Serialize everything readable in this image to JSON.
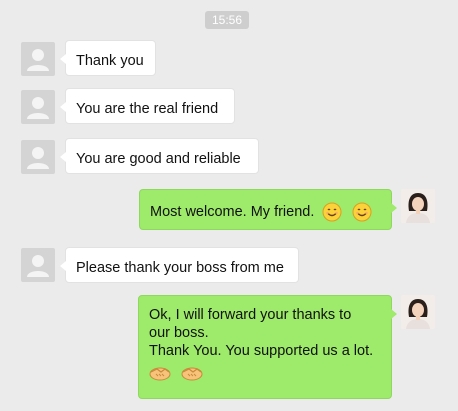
{
  "chat": {
    "timestamp": "15:56",
    "messages": [
      {
        "direction": "incoming",
        "text": "Thank you"
      },
      {
        "direction": "incoming",
        "text": "You are the real friend"
      },
      {
        "direction": "incoming",
        "text": "You are good and reliable"
      },
      {
        "direction": "outgoing",
        "text": "Most welcome. My friend.",
        "emojis": [
          "smile-emoji",
          "smile-emoji"
        ]
      },
      {
        "direction": "incoming",
        "text": "Please thank your boss from me"
      },
      {
        "direction": "outgoing",
        "lines": [
          "Ok, I will forward your thanks to",
          "our boss.",
          "Thank You. You supported us a lot."
        ],
        "emojis": [
          "handshake-emoji",
          "handshake-emoji"
        ]
      }
    ]
  },
  "colors": {
    "background": "#ebebeb",
    "incoming_bubble": "#ffffff",
    "outgoing_bubble": "#9eea6a",
    "timestamp_pill": "#cecece"
  }
}
